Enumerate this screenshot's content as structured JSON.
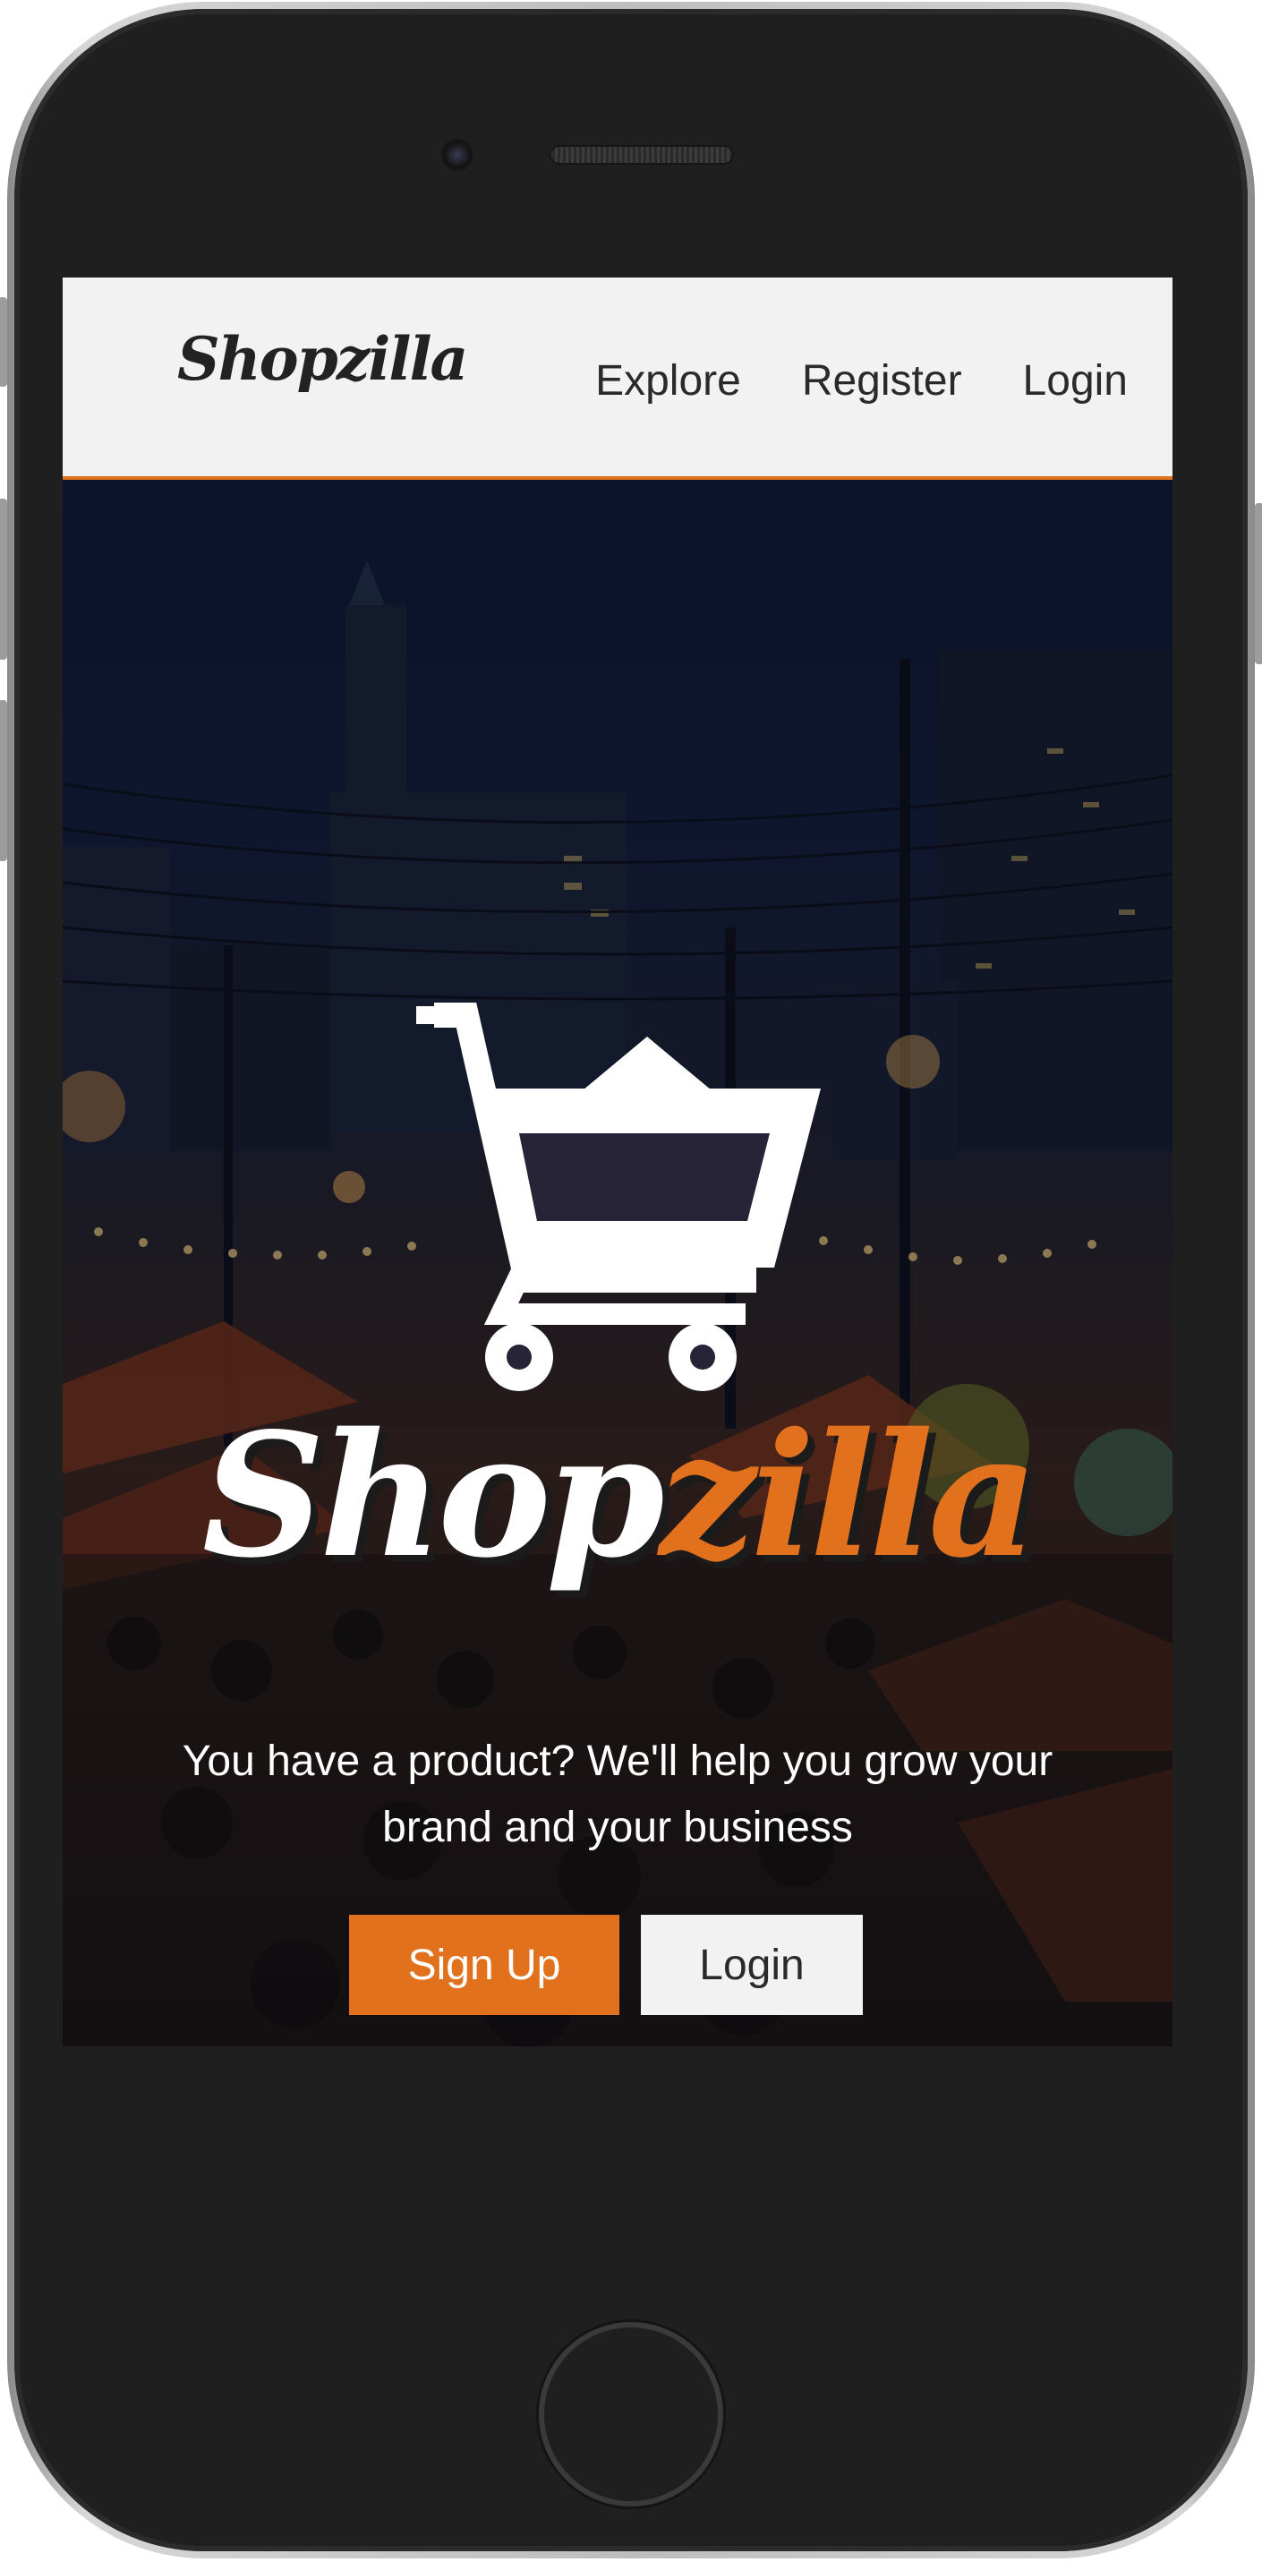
{
  "nav": {
    "logo": "Shopzilla",
    "links": [
      "Explore",
      "Register",
      "Login"
    ]
  },
  "hero": {
    "brand_first": "Shop",
    "brand_second": "zilla",
    "tagline": "You have a product? We'll help you grow your brand and your business",
    "signup_label": "Sign Up",
    "login_label": "Login"
  },
  "colors": {
    "accent": "#e2711d",
    "navbar_bg": "#f2f2f2",
    "text_dark": "#2a2a2a",
    "phone_body": "#1f1f1f"
  },
  "icons": [
    "shopping-cart-icon"
  ]
}
